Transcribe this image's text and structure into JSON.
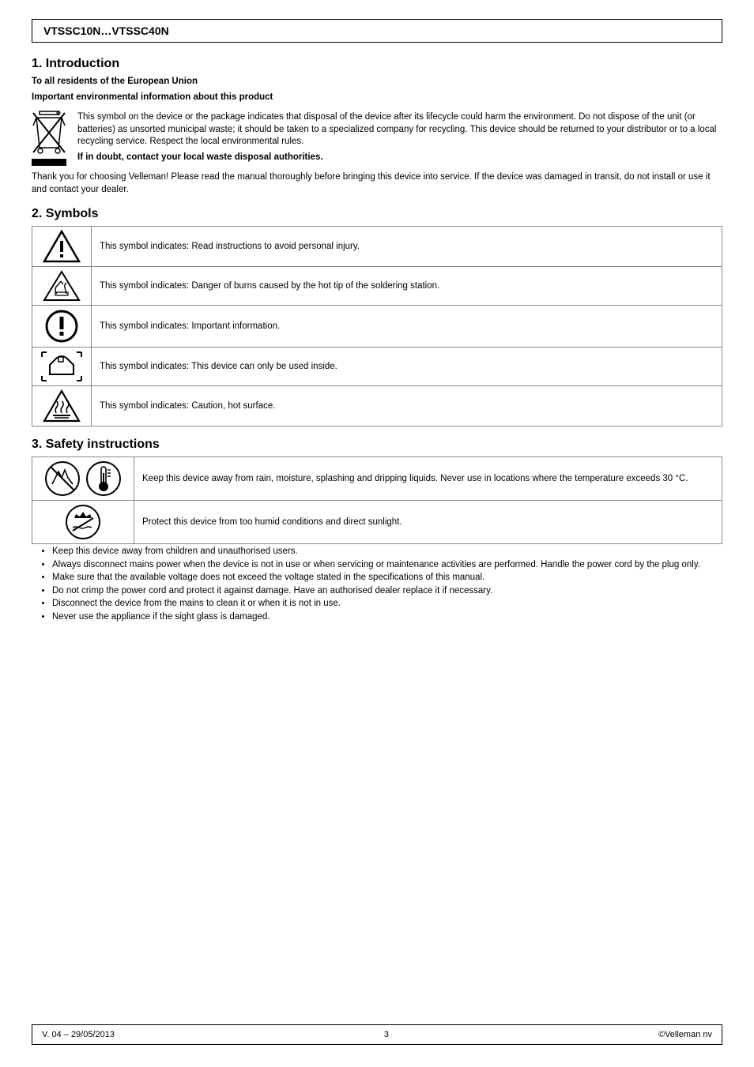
{
  "header": {
    "product": "VTSSC10N…VTSSC40N"
  },
  "intro": {
    "title": "1. Introduction",
    "thanks_line": "To all residents of the European Union",
    "env_line": "Important environmental information about this product",
    "weee_text": "This symbol on the device or the package indicates that disposal of the device after its lifecycle could harm the environment. Do not dispose of the unit (or batteries) as unsorted municipal waste; it should be taken to a specialized company for recycling. This device should be returned to your distributor or to a local recycling service. Respect the local environmental rules.",
    "doubt_line": "If in doubt, contact your local waste disposal authorities.",
    "closing": "Thank you for choosing Velleman! Please read the manual thoroughly before bringing this device into service. If the device was damaged in transit, do not install or use it and contact your dealer."
  },
  "symbols": {
    "title": "2. Symbols",
    "rows": [
      {
        "icon": "warning-triangle",
        "text": "This symbol indicates: Read instructions to avoid personal injury."
      },
      {
        "icon": "burn-hand-triangle",
        "text": "This symbol indicates: Danger of burns caused by the hot tip of the soldering station."
      },
      {
        "icon": "exclamation-circle",
        "text": "This symbol indicates: Important information."
      },
      {
        "icon": "indoor-use",
        "text": "This symbol indicates: This device can only be used inside."
      },
      {
        "icon": "hot-surface-triangle",
        "text": "This symbol indicates: Caution, hot surface."
      }
    ]
  },
  "safety": {
    "title": "3. Safety instructions",
    "rows": [
      {
        "icons": [
          "no-moisture-circle",
          "thermometer-circle"
        ],
        "text": "Keep this device away from rain, moisture, splashing and dripping liquids. Never use in locations where the temperature exceeds 30 °C."
      },
      {
        "icons": [
          "no-sun-circle"
        ],
        "text": "Protect this device from too humid conditions and direct sunlight."
      }
    ],
    "bullets": [
      "Keep this device away from children and unauthorised users.",
      "Always disconnect mains power when the device is not in use or when servicing or maintenance activities are performed. Handle the power cord by the plug only.",
      "Make sure that the available voltage does not exceed the voltage stated in the specifications of this manual.",
      "Do not crimp the power cord and protect it against damage. Have an authorised dealer replace it if necessary.",
      "Disconnect the device from the mains to clean it or when it is not in use.",
      "Never use the appliance if the sight glass is damaged."
    ]
  },
  "footer": {
    "left": "V. 04 – 29/05/2013",
    "center": "3",
    "right": "©Velleman nv"
  }
}
